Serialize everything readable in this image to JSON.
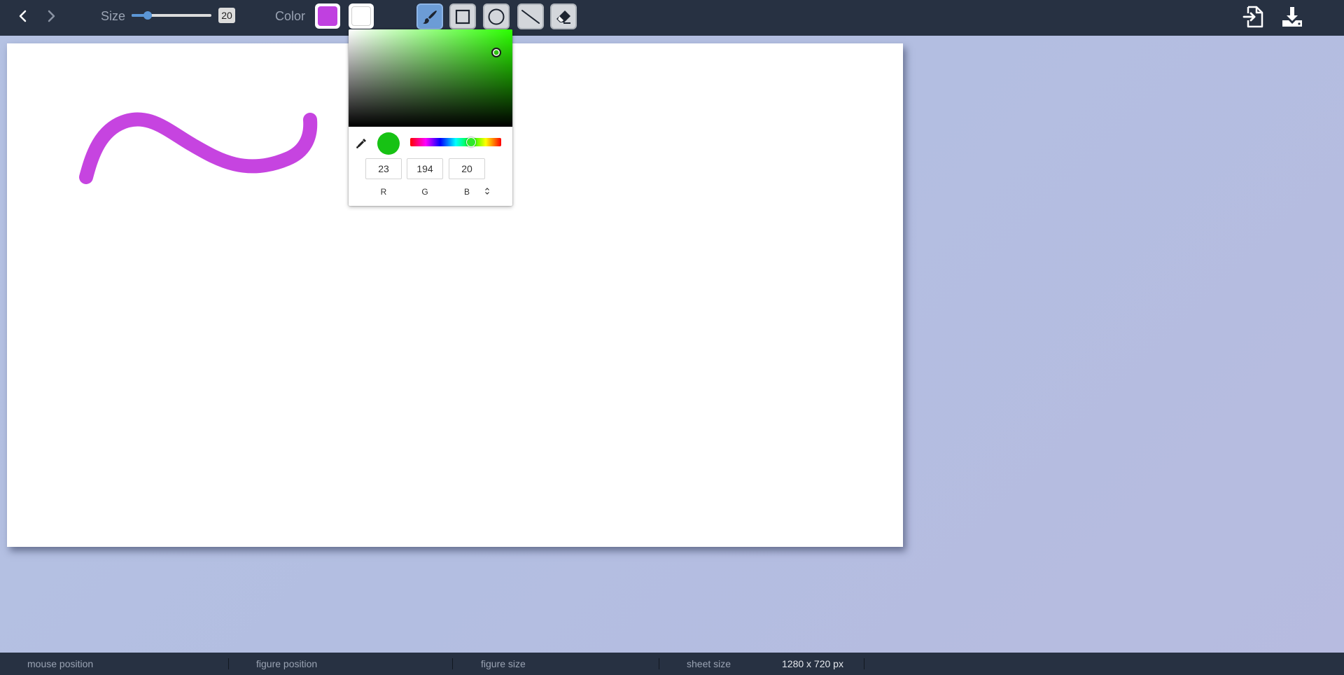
{
  "toolbar": {
    "size_label": "Size",
    "size_value": "20",
    "size_fraction": 0.2,
    "color_label": "Color",
    "primary_color": "#c040e0",
    "secondary_color": "#ffffff",
    "tools": [
      {
        "name": "brush",
        "active": true
      },
      {
        "name": "rectangle",
        "active": false
      },
      {
        "name": "ellipse",
        "active": false
      },
      {
        "name": "line",
        "active": false
      },
      {
        "name": "eraser",
        "active": false
      }
    ],
    "toolbar_bg": "#273142",
    "active_tool_color": "#6c9cd6"
  },
  "color_picker": {
    "hue_color": "#2bff00",
    "selected_color": "#17c214",
    "r": "23",
    "g": "194",
    "b": "20",
    "r_label": "R",
    "g_label": "G",
    "b_label": "B",
    "hue_degrees": 118,
    "saturation": 0.9,
    "value": 0.76
  },
  "canvas": {
    "stroke_color": "#c644e0",
    "stroke_width": 20
  },
  "statusbar": {
    "mouse_position_label": "mouse position",
    "figure_position_label": "figure position",
    "figure_size_label": "figure size",
    "sheet_size_label": "sheet size",
    "sheet_size_value": "1280 x 720 px"
  }
}
